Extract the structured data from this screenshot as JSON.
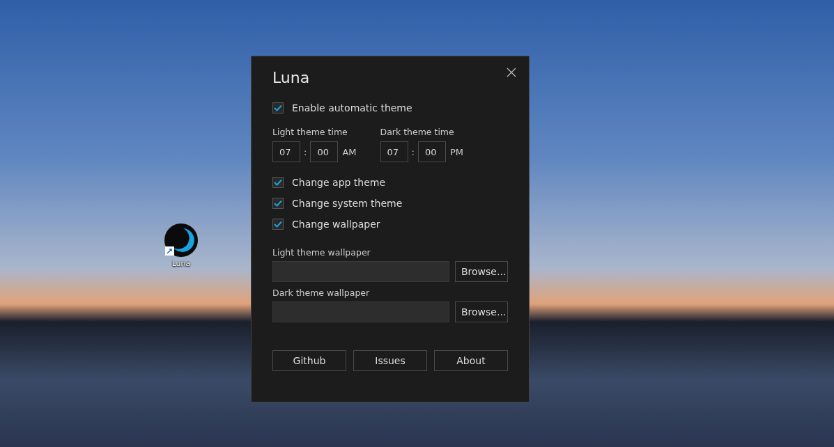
{
  "desktop": {
    "icons": [
      {
        "label": "Luna"
      }
    ]
  },
  "dialog": {
    "title": "Luna",
    "auto_theme": {
      "label": "Enable automatic theme",
      "checked": true
    },
    "times": [
      {
        "label": "Light theme time",
        "hour": "07",
        "separator": ":",
        "minute": "00",
        "period": "AM"
      },
      {
        "label": "Dark theme time",
        "hour": "07",
        "separator": ":",
        "minute": "00",
        "period": "PM"
      }
    ],
    "options": [
      {
        "label": "Change app theme",
        "checked": true
      },
      {
        "label": "Change system theme",
        "checked": true
      },
      {
        "label": "Change wallpaper",
        "checked": true
      }
    ],
    "wallpapers": [
      {
        "label": "Light theme wallpaper",
        "button": "Browse..."
      },
      {
        "label": "Dark theme wallpaper",
        "button": "Browse..."
      }
    ],
    "buttons": [
      "Github",
      "Issues",
      "About"
    ]
  }
}
